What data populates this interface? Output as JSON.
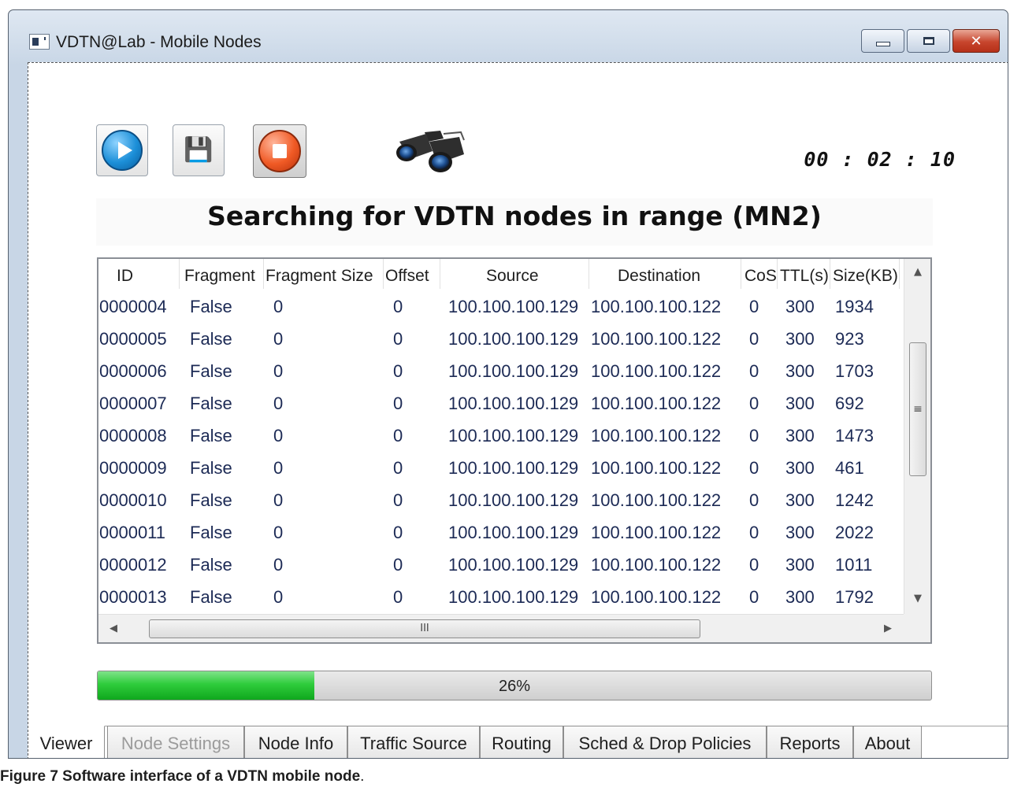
{
  "window": {
    "title": "VDTN@Lab - Mobile Nodes",
    "controls": {
      "minimize": "minimize",
      "maximize": "maximize",
      "close": "✕"
    }
  },
  "toolbar": {
    "play_icon": "play-icon",
    "save_icon": "save-icon",
    "save_glyph": "💾",
    "stop_icon": "stop-icon",
    "search_icon": "binoculars-icon",
    "timer": "00 : 02 : 10"
  },
  "heading": "Searching for VDTN nodes in range (MN2)",
  "grid": {
    "columns": [
      "ID",
      "Fragment",
      "Fragment Size",
      "Offset",
      "Source",
      "Destination",
      "CoS",
      "TTL(s)",
      "Size(KB)"
    ],
    "rows": [
      [
        "0000004",
        "False",
        "0",
        "0",
        "100.100.100.129",
        "100.100.100.122",
        "0",
        "300",
        "1934"
      ],
      [
        "0000005",
        "False",
        "0",
        "0",
        "100.100.100.129",
        "100.100.100.122",
        "0",
        "300",
        "923"
      ],
      [
        "0000006",
        "False",
        "0",
        "0",
        "100.100.100.129",
        "100.100.100.122",
        "0",
        "300",
        "1703"
      ],
      [
        "0000007",
        "False",
        "0",
        "0",
        "100.100.100.129",
        "100.100.100.122",
        "0",
        "300",
        "692"
      ],
      [
        "0000008",
        "False",
        "0",
        "0",
        "100.100.100.129",
        "100.100.100.122",
        "0",
        "300",
        "1473"
      ],
      [
        "0000009",
        "False",
        "0",
        "0",
        "100.100.100.129",
        "100.100.100.122",
        "0",
        "300",
        "461"
      ],
      [
        "0000010",
        "False",
        "0",
        "0",
        "100.100.100.129",
        "100.100.100.122",
        "0",
        "300",
        "1242"
      ],
      [
        "0000011",
        "False",
        "0",
        "0",
        "100.100.100.129",
        "100.100.100.122",
        "0",
        "300",
        "2022"
      ],
      [
        "0000012",
        "False",
        "0",
        "0",
        "100.100.100.129",
        "100.100.100.122",
        "0",
        "300",
        "1011"
      ],
      [
        "0000013",
        "False",
        "0",
        "0",
        "100.100.100.129",
        "100.100.100.122",
        "0",
        "300",
        "1792"
      ]
    ],
    "vscroll_grip": "≡",
    "hscroll_grip": "III",
    "arrows": {
      "up": "▲",
      "down": "▼",
      "left": "◀",
      "right": "▶"
    }
  },
  "progress": {
    "value": 0.26,
    "label": "26%"
  },
  "tabs": [
    {
      "label": "Viewer",
      "state": "active"
    },
    {
      "label": "Node Settings",
      "state": "disabled"
    },
    {
      "label": "Node Info",
      "state": "normal"
    },
    {
      "label": "Traffic Source",
      "state": "normal"
    },
    {
      "label": "Routing",
      "state": "normal"
    },
    {
      "label": "Sched & Drop Policies",
      "state": "normal"
    },
    {
      "label": "Reports",
      "state": "normal"
    },
    {
      "label": "About",
      "state": "normal"
    }
  ],
  "caption": {
    "label": "Figure 7 Software interface of a VDTN mobile node",
    "end": "."
  },
  "colors": {
    "progress_fill": "#2fcc3c",
    "close_button": "#c7452d",
    "cell_text": "#1c2a55"
  }
}
